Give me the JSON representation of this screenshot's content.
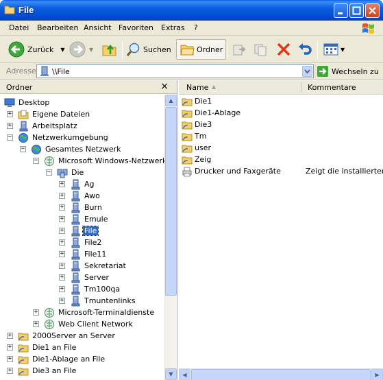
{
  "window": {
    "title": "File"
  },
  "menu": [
    {
      "label": "Datei"
    },
    {
      "label": "Bearbeiten"
    },
    {
      "label": "Ansicht"
    },
    {
      "label": "Favoriten"
    },
    {
      "label": "Extras"
    },
    {
      "label": "?"
    }
  ],
  "toolbar": {
    "back_label": "Zurück",
    "search_label": "Suchen",
    "folders_label": "Ordner"
  },
  "address": {
    "label": "Adresse",
    "value": "\\\\File",
    "go_label": "Wechseln zu"
  },
  "folder_pane": {
    "title": "Ordner",
    "close_glyph": "×",
    "nodes": [
      {
        "label": "Desktop",
        "icon": "desktop-icon"
      },
      {
        "label": "Eigene Dateien",
        "icon": "my-documents-icon",
        "expander": "+"
      },
      {
        "label": "Arbeitsplatz",
        "icon": "my-computer-icon",
        "expander": "+"
      },
      {
        "label": "Netzwerkumgebung",
        "icon": "network-places-icon",
        "expander": "−"
      },
      {
        "label": "Gesamtes Netzwerk",
        "icon": "entire-network-icon",
        "expander": "−"
      },
      {
        "label": "Microsoft Windows-Netzwerk",
        "icon": "windows-network-icon",
        "expander": "−"
      },
      {
        "label": "Die",
        "icon": "workgroup-icon",
        "expander": "−"
      },
      {
        "label": "Ag",
        "icon": "computer-icon",
        "expander": "+"
      },
      {
        "label": "Awo",
        "icon": "computer-icon",
        "expander": "+"
      },
      {
        "label": "Burn",
        "icon": "computer-icon",
        "expander": "+"
      },
      {
        "label": "Emule",
        "icon": "computer-icon",
        "expander": "+"
      },
      {
        "label": "File",
        "icon": "computer-icon",
        "expander": "+",
        "selected": true
      },
      {
        "label": "File2",
        "icon": "computer-icon",
        "expander": "+"
      },
      {
        "label": "File11",
        "icon": "computer-icon",
        "expander": "+"
      },
      {
        "label": "Sekretariat",
        "icon": "computer-icon",
        "expander": "+"
      },
      {
        "label": "Server",
        "icon": "computer-icon",
        "expander": "+"
      },
      {
        "label": "Tm100qa",
        "icon": "computer-icon",
        "expander": "+"
      },
      {
        "label": "Tmuntenlinks",
        "icon": "computer-icon",
        "expander": "+"
      },
      {
        "label": "Microsoft-Terminaldienste",
        "icon": "terminal-services-icon",
        "expander": "+"
      },
      {
        "label": "Web Client Network",
        "icon": "web-client-icon",
        "expander": "+"
      },
      {
        "label": "2000Server an Server",
        "icon": "shared-folder-icon",
        "expander": "+"
      },
      {
        "label": "Die1 an File",
        "icon": "shared-folder-icon",
        "expander": "+"
      },
      {
        "label": "Die1-Ablage an File",
        "icon": "shared-folder-icon",
        "expander": "+"
      },
      {
        "label": "Die3 an File",
        "icon": "shared-folder-icon",
        "expander": "+"
      }
    ]
  },
  "file_list": {
    "columns": [
      {
        "label": "Name"
      },
      {
        "label": "Kommentare"
      }
    ],
    "rows": [
      {
        "name": "Die1",
        "icon": "shared-folder-icon",
        "comment": ""
      },
      {
        "name": "Die1-Ablage",
        "icon": "shared-folder-icon",
        "comment": ""
      },
      {
        "name": "Die3",
        "icon": "shared-folder-icon",
        "comment": ""
      },
      {
        "name": "Tm",
        "icon": "shared-folder-icon",
        "comment": ""
      },
      {
        "name": "user",
        "icon": "shared-folder-icon",
        "comment": ""
      },
      {
        "name": "Zeig",
        "icon": "shared-folder-icon",
        "comment": ""
      },
      {
        "name": "Drucker und Faxgeräte",
        "icon": "printers-faxes-icon",
        "comment": "Zeigt die installierten D"
      }
    ]
  },
  "colors": {
    "titlebar": "#0054e3",
    "chrome": "#ece9d8",
    "selection": "#316ac5"
  }
}
